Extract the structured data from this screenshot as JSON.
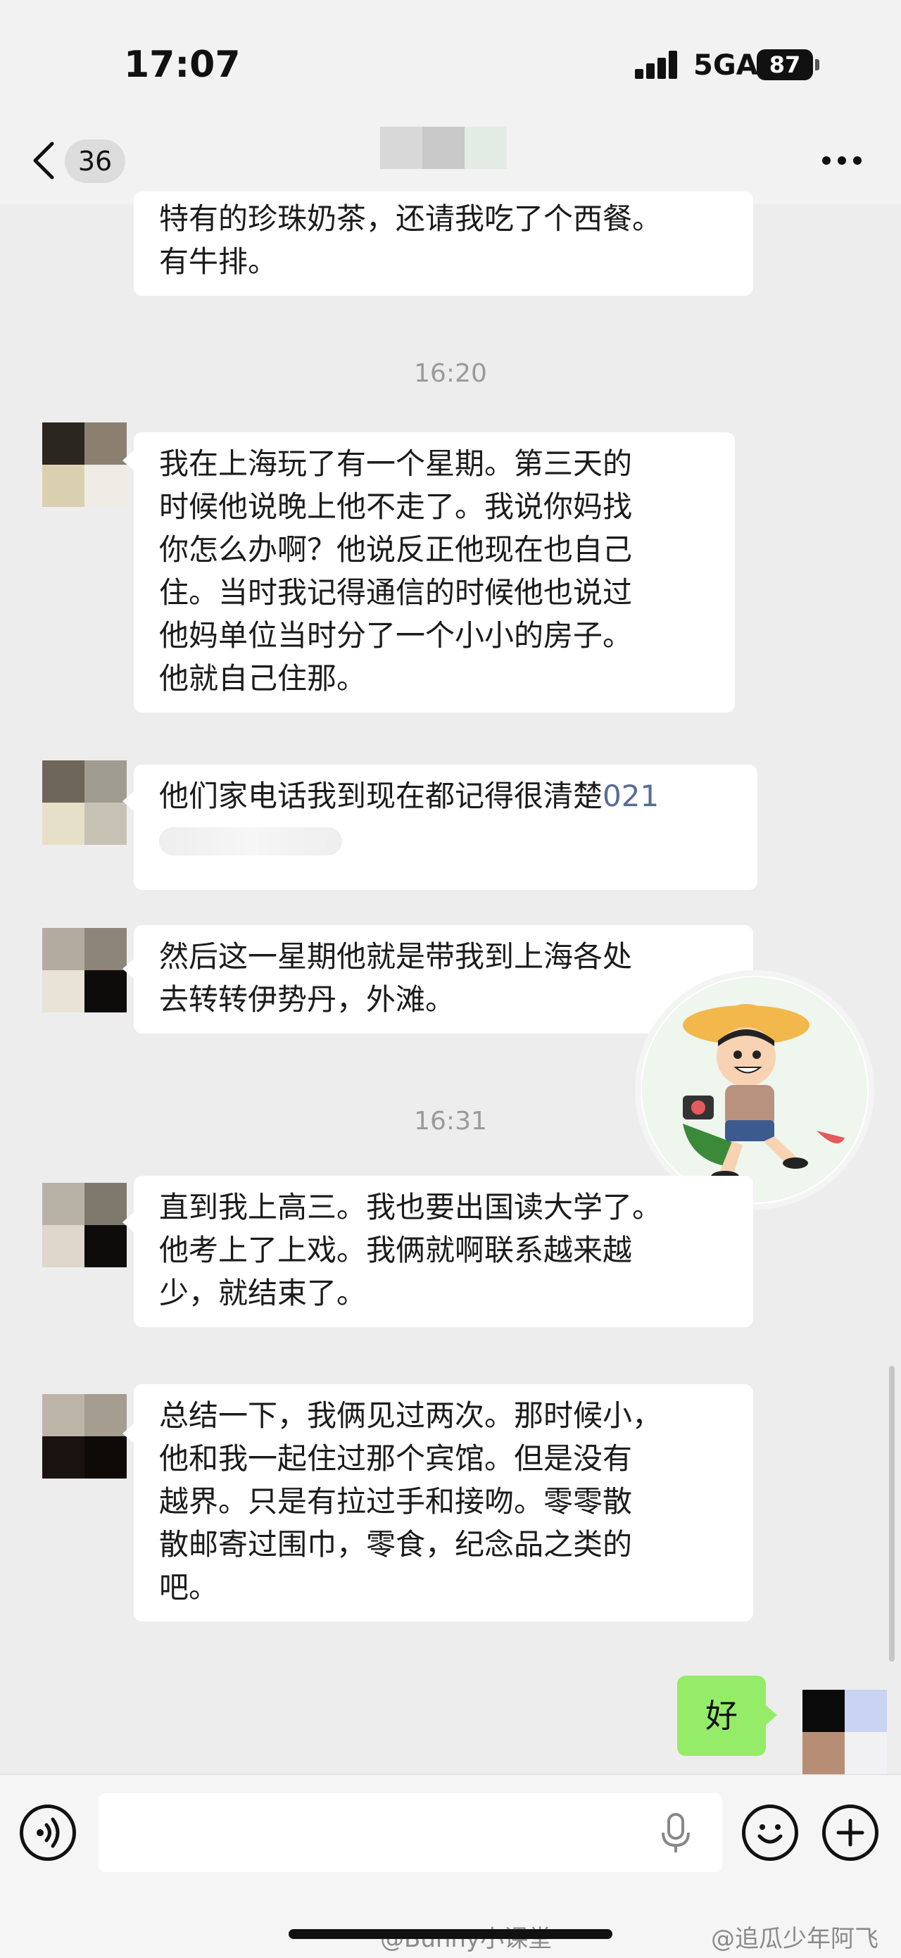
{
  "status_bar": {
    "time": "17:07",
    "network": "5GA",
    "battery": "87"
  },
  "nav": {
    "unread_count": "36",
    "more_icon": "more-icon"
  },
  "messages": [
    {
      "type": "received",
      "lines": [
        "特有的珍珠奶茶，还请我吃了个西餐。",
        "有牛排。"
      ]
    },
    {
      "type": "time",
      "text": "16:20"
    },
    {
      "type": "received",
      "lines": [
        "我在上海玩了有一个星期。第三天的",
        "时候他说晚上他不走了。我说你妈找",
        "你怎么办啊？他说反正他现在也自己",
        "住。当时我记得通信的时候他也说过",
        "他妈单位当时分了一个小小的房子。",
        "他就自己住那。"
      ]
    },
    {
      "type": "received",
      "text_prefix": "他们家电话我到现在都记得很清楚",
      "phone": "021"
    },
    {
      "type": "received",
      "lines": [
        "然后这一星期他就是带我到上海各处",
        "去转转伊势丹，外滩。"
      ]
    },
    {
      "type": "time",
      "text": "16:31"
    },
    {
      "type": "received",
      "lines": [
        "直到我上高三。我也要出国读大学了。",
        "他考上了上戏。我俩就啊联系越来越",
        "少，就结束了。"
      ]
    },
    {
      "type": "received",
      "lines": [
        "总结一下，我俩见过两次。那时候小，",
        "他和我一起住过那个宾馆。但是没有",
        "越界。只是有拉过手和接吻。零零散",
        "散邮寄过围巾，零食，纪念品之类的",
        "吧。"
      ]
    },
    {
      "type": "sent",
      "text": "好"
    }
  ],
  "input": {
    "placeholder": ""
  },
  "watermarks": {
    "left": "@Bunny小课堂",
    "right": "@追瓜少年阿飞"
  },
  "colors": {
    "background": "#ededed",
    "received_bubble": "#ffffff",
    "sent_bubble": "#95ec69",
    "phone_link": "#576b95"
  }
}
